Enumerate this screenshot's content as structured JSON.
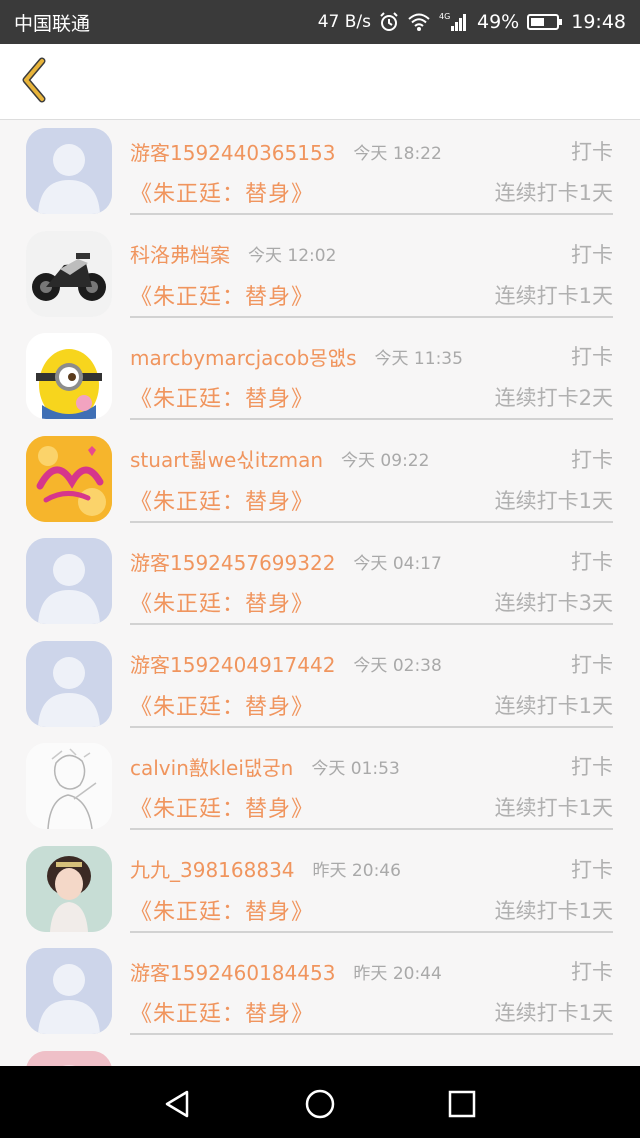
{
  "status_bar": {
    "carrier": "中国联通",
    "net_speed": "47 B/s",
    "battery": "49%",
    "time": "19:48",
    "network_label": "4G",
    "icons": [
      "alarm-icon",
      "wifi-icon",
      "signal-icon",
      "battery-icon"
    ]
  },
  "header": {
    "back_icon": "chevron-left-icon",
    "accent_color": "#e8b43a"
  },
  "colors": {
    "accent": "#f0955e",
    "muted": "#a9a9a9",
    "background": "#f7f6f6"
  },
  "list": [
    {
      "username": "游客1592440365153",
      "time": "今天 18:22",
      "action": "打卡",
      "book": "《朱正廷：替身》",
      "streak": "连续打卡1天",
      "avatar": "default-avatar"
    },
    {
      "username": "科洛弗档案",
      "time": "今天 12:02",
      "action": "打卡",
      "book": "《朱正廷：替身》",
      "streak": "连续打卡1天",
      "avatar": "motorcycle-avatar"
    },
    {
      "username": "marcbymarcjacob몽얪s",
      "time": "今天 11:35",
      "action": "打卡",
      "book": "《朱正廷：替身》",
      "streak": "连续打卡2天",
      "avatar": "minion-avatar"
    },
    {
      "username": "stuart뢻we싟itzman",
      "time": "今天 09:22",
      "action": "打卡",
      "book": "《朱正廷：替身》",
      "streak": "连续打卡1天",
      "avatar": "valentine-avatar"
    },
    {
      "username": "游客1592457699322",
      "time": "今天 04:17",
      "action": "打卡",
      "book": "《朱正廷：替身》",
      "streak": "连续打卡3天",
      "avatar": "default-avatar"
    },
    {
      "username": "游客1592404917442",
      "time": "今天 02:38",
      "action": "打卡",
      "book": "《朱正廷：替身》",
      "streak": "连续打卡1天",
      "avatar": "default-avatar"
    },
    {
      "username": "calvin敾klei댒궁n",
      "time": "今天 01:53",
      "action": "打卡",
      "book": "《朱正廷：替身》",
      "streak": "连续打卡1天",
      "avatar": "sketch-avatar"
    },
    {
      "username": "九九_398168834",
      "time": "昨天 20:46",
      "action": "打卡",
      "book": "《朱正廷：替身》",
      "streak": "连续打卡1天",
      "avatar": "girl-avatar"
    },
    {
      "username": "游客1592460184453",
      "time": "昨天 20:44",
      "action": "打卡",
      "book": "《朱正廷：替身》",
      "streak": "连续打卡1天",
      "avatar": "default-avatar"
    },
    {
      "username": "",
      "time": "",
      "action": "",
      "book": "",
      "streak": "",
      "avatar": "pink-avatar"
    }
  ],
  "nav_bar": {
    "icons": [
      "back-triangle-icon",
      "home-circle-icon",
      "recents-square-icon"
    ]
  }
}
